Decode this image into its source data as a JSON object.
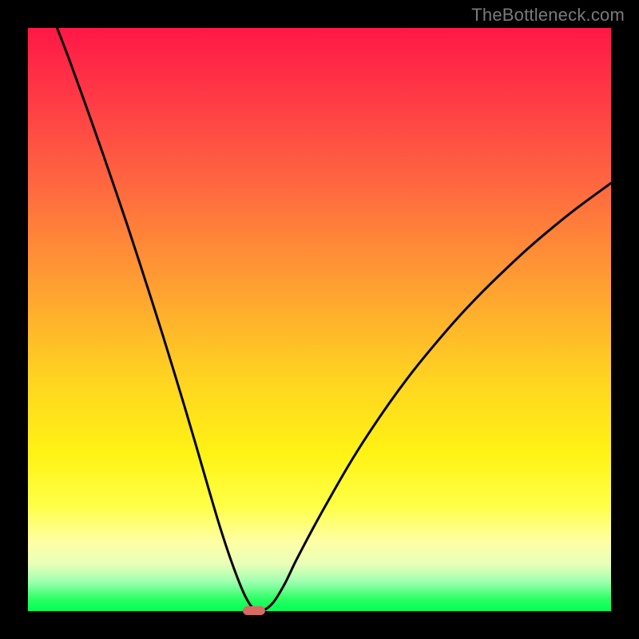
{
  "watermark": {
    "text": "TheBottleneck.com"
  },
  "chart_data": {
    "type": "line",
    "title": "",
    "xlabel": "",
    "ylabel": "",
    "xlim": [
      0,
      100
    ],
    "ylim": [
      0,
      100
    ],
    "grid": false,
    "series": [
      {
        "name": "bottleneck-curve",
        "x": [
          5,
          7,
          9,
          11,
          13,
          15,
          17,
          19,
          21,
          23,
          25,
          27,
          29,
          31,
          33,
          35,
          37,
          38.5,
          40,
          42,
          44,
          46,
          49,
          52,
          55,
          58,
          62,
          66,
          70,
          74,
          78,
          82,
          86,
          90,
          94,
          100
        ],
        "y": [
          100,
          94.8,
          89.3,
          83.7,
          78.0,
          72.2,
          66.3,
          60.2,
          54.0,
          47.7,
          41.2,
          34.6,
          27.8,
          20.9,
          14.2,
          8.2,
          3.1,
          0.6,
          0,
          1.4,
          4.6,
          8.7,
          14.4,
          19.8,
          25.0,
          29.8,
          35.7,
          41.1,
          46.0,
          50.6,
          54.8,
          58.7,
          62.4,
          65.8,
          69.0,
          73.4
        ]
      }
    ],
    "marker": {
      "x": 38.8,
      "y": 0
    },
    "colors": {
      "curve": "#000000",
      "marker": "#d86a62",
      "gradient_top": "#ff1846",
      "gradient_bottom": "#00ff57"
    }
  }
}
